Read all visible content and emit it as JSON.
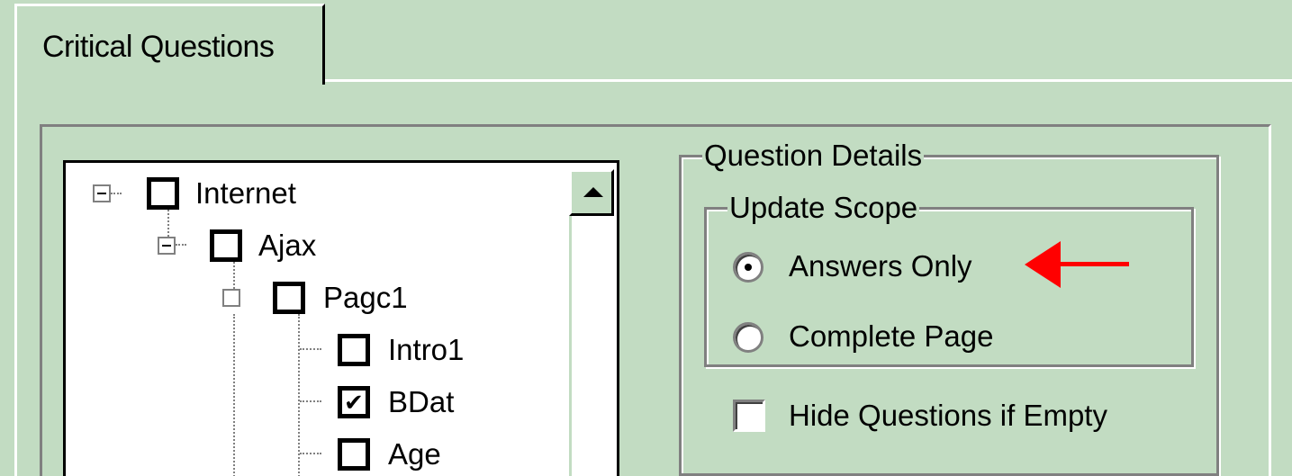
{
  "tab": {
    "label": "Critical Questions"
  },
  "tree": {
    "nodes": [
      {
        "label": "Internet",
        "checked": false
      },
      {
        "label": "Ajax",
        "checked": false
      },
      {
        "label": "Pagc1",
        "checked": false
      },
      {
        "label": "Intro1",
        "checked": false
      },
      {
        "label": "BDat",
        "checked": true,
        "check_glyph": "✔"
      },
      {
        "label": "Age",
        "checked": false
      }
    ]
  },
  "question_details": {
    "legend": "Question Details",
    "update_scope": {
      "legend": "Update Scope",
      "options": [
        {
          "label": "Answers Only",
          "selected": true
        },
        {
          "label": "Complete Page",
          "selected": false
        }
      ]
    },
    "hide_if_empty": {
      "label": "Hide Questions if Empty",
      "checked": false
    }
  },
  "annotation": {
    "color": "#ff0000",
    "icon": "left-arrow-icon"
  }
}
